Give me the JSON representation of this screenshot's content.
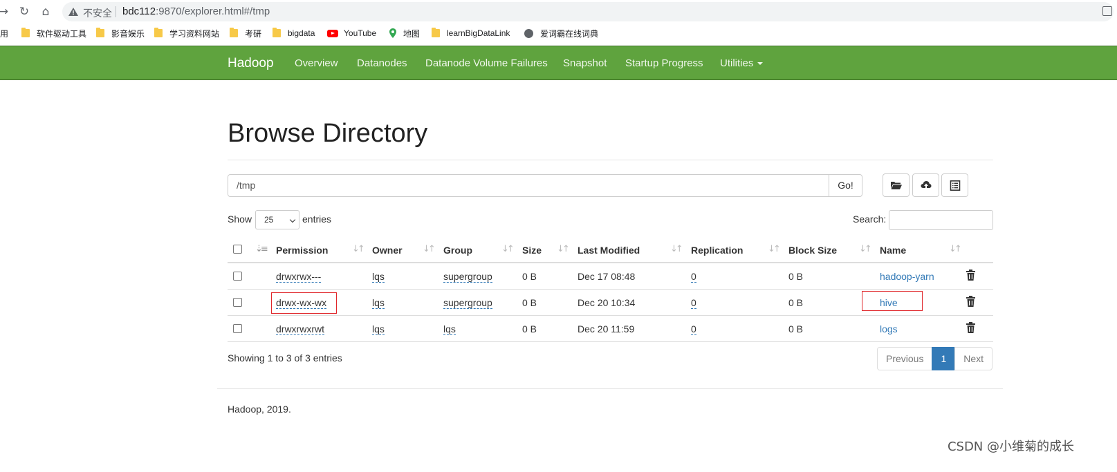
{
  "browser": {
    "url_warning": "不安全",
    "url_host": "bdc112",
    "url_rest": ":9870/explorer.html#/tmp",
    "bookmarks_prefix": "用",
    "bookmarks": [
      {
        "label": "软件驱动工具",
        "icon": "folder-icon"
      },
      {
        "label": "影音娱乐",
        "icon": "folder-icon"
      },
      {
        "label": "学习资料网站",
        "icon": "folder-icon"
      },
      {
        "label": "考研",
        "icon": "folder-icon"
      },
      {
        "label": "bigdata",
        "icon": "folder-icon"
      },
      {
        "label": "YouTube",
        "icon": "youtube-icon"
      },
      {
        "label": "地图",
        "icon": "maps-pin-icon"
      },
      {
        "label": "learnBigDataLink",
        "icon": "folder-icon"
      },
      {
        "label": "爱词霸在线词典",
        "icon": "globe-icon"
      }
    ]
  },
  "navbar": {
    "brand": "Hadoop",
    "items": [
      "Overview",
      "Datanodes",
      "Datanode Volume Failures",
      "Snapshot",
      "Startup Progress",
      "Utilities"
    ],
    "color": "#5fa33e"
  },
  "main": {
    "title": "Browse Directory",
    "path_value": "/tmp",
    "go_label": "Go!",
    "show_label": "Show",
    "entries_value": "25",
    "entries_label": "entries",
    "search_label": "Search:",
    "search_value": ""
  },
  "table": {
    "headers": [
      "Permission",
      "Owner",
      "Group",
      "Size",
      "Last Modified",
      "Replication",
      "Block Size",
      "Name"
    ],
    "rows": [
      {
        "permission": "drwxrwx---",
        "owner": "lqs",
        "group": "supergroup",
        "size": "0 B",
        "modified": "Dec 17 08:48",
        "replication": "0",
        "block_size": "0 B",
        "name": "hadoop-yarn"
      },
      {
        "permission": "drwx-wx-wx",
        "owner": "lqs",
        "group": "supergroup",
        "size": "0 B",
        "modified": "Dec 20 10:34",
        "replication": "0",
        "block_size": "0 B",
        "name": "hive"
      },
      {
        "permission": "drwxrwxrwt",
        "owner": "lqs",
        "group": "lqs",
        "size": "0 B",
        "modified": "Dec 20 11:59",
        "replication": "0",
        "block_size": "0 B",
        "name": "logs"
      }
    ]
  },
  "pagination": {
    "info": "Showing 1 to 3 of 3 entries",
    "previous": "Previous",
    "current": "1",
    "next": "Next"
  },
  "footer": "Hadoop, 2019.",
  "watermark": "CSDN @小维菊的成长",
  "colors": {
    "link": "#337ab7",
    "highlight": "#e0262a",
    "active_page": "#337ab7"
  }
}
